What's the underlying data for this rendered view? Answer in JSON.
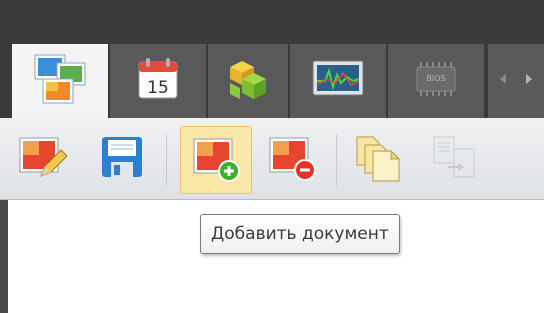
{
  "tabs": [
    {
      "name": "documents-tab",
      "icon": "documents-icon",
      "active": true
    },
    {
      "name": "calendar-tab",
      "icon": "calendar-icon",
      "label": "15",
      "active": false
    },
    {
      "name": "components-tab",
      "icon": "cubes-icon",
      "active": false
    },
    {
      "name": "monitor-tab",
      "icon": "monitor-graph-icon",
      "active": false
    },
    {
      "name": "bios-tab",
      "icon": "bios-chip-icon",
      "label": "BIOS",
      "active": false
    }
  ],
  "tab_scroll": {
    "left_icon": "chevron-left-icon",
    "right_icon": "chevron-right-icon"
  },
  "toolbar": {
    "buttons": [
      {
        "name": "edit-document-button",
        "icon": "image-pencil-icon"
      },
      {
        "name": "save-button",
        "icon": "floppy-disk-icon"
      },
      {
        "name": "add-document-button",
        "icon": "image-add-icon",
        "hovered": true
      },
      {
        "name": "remove-document-button",
        "icon": "image-remove-icon"
      },
      {
        "name": "copy-documents-button",
        "icon": "copy-icon"
      },
      {
        "name": "convert-document-button",
        "icon": "convert-icon",
        "disabled": true
      }
    ]
  },
  "tooltip": {
    "text": "Добавить документ"
  }
}
